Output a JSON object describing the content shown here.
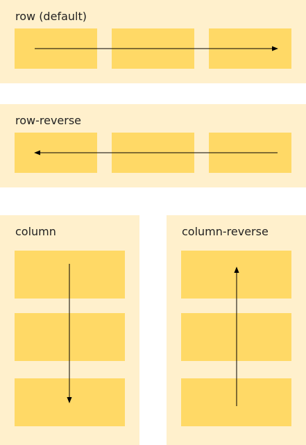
{
  "panels": {
    "row": {
      "label": "row (default)",
      "direction": "row"
    },
    "row_reverse": {
      "label": "row-reverse",
      "direction": "row-reverse"
    },
    "column": {
      "label": "column",
      "direction": "column"
    },
    "column_reverse": {
      "label": "column-reverse",
      "direction": "column-reverse"
    }
  },
  "colors": {
    "panel_background": "#fff0cc",
    "item_fill": "#ffd966",
    "arrow": "#000000"
  }
}
